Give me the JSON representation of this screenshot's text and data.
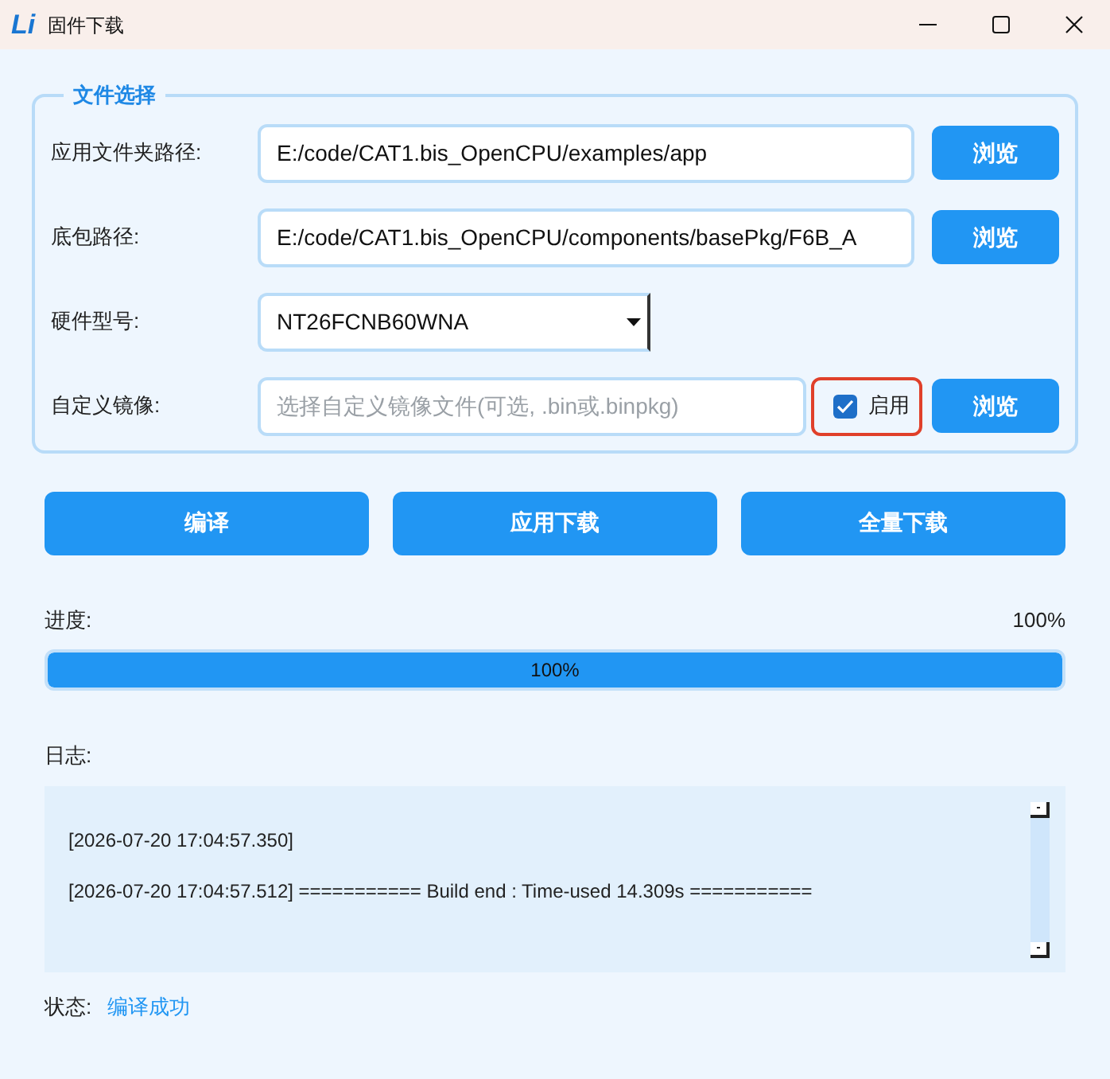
{
  "window": {
    "logo": "Li",
    "title": "固件下载"
  },
  "file_selection": {
    "title": "文件选择",
    "rows": [
      {
        "kind": "path",
        "label": "应用文件夹路径:",
        "value": "E:/code/CAT1.bis_OpenCPU/examples/app",
        "button": "浏览"
      },
      {
        "kind": "path",
        "label": "底包路径:",
        "value": "E:/code/CAT1.bis_OpenCPU/components/basePkg/F6B_A",
        "button": "浏览"
      },
      {
        "kind": "select",
        "label": "硬件型号:",
        "value": "NT26FCNB60WNA"
      },
      {
        "kind": "custom",
        "label": "自定义镜像:",
        "placeholder": "选择自定义镜像文件(可选, .bin或.binpkg)",
        "checkbox": {
          "label": "启用",
          "checked": true,
          "highlighted": true
        },
        "button": "浏览"
      }
    ]
  },
  "actions": [
    "编译",
    "应用下载",
    "全量下载"
  ],
  "progress": {
    "label": "进度:",
    "reading": "100%",
    "level": 1,
    "bar_text": "100%"
  },
  "log": {
    "label": "日志:",
    "lines": [
      "[2026-07-20 17:04:57.350]",
      "[2026-07-20 17:04:57.512] =========== Build end : Time-used 14.309s ==========="
    ]
  },
  "status": {
    "label": "状态:",
    "value": "编译成功"
  }
}
